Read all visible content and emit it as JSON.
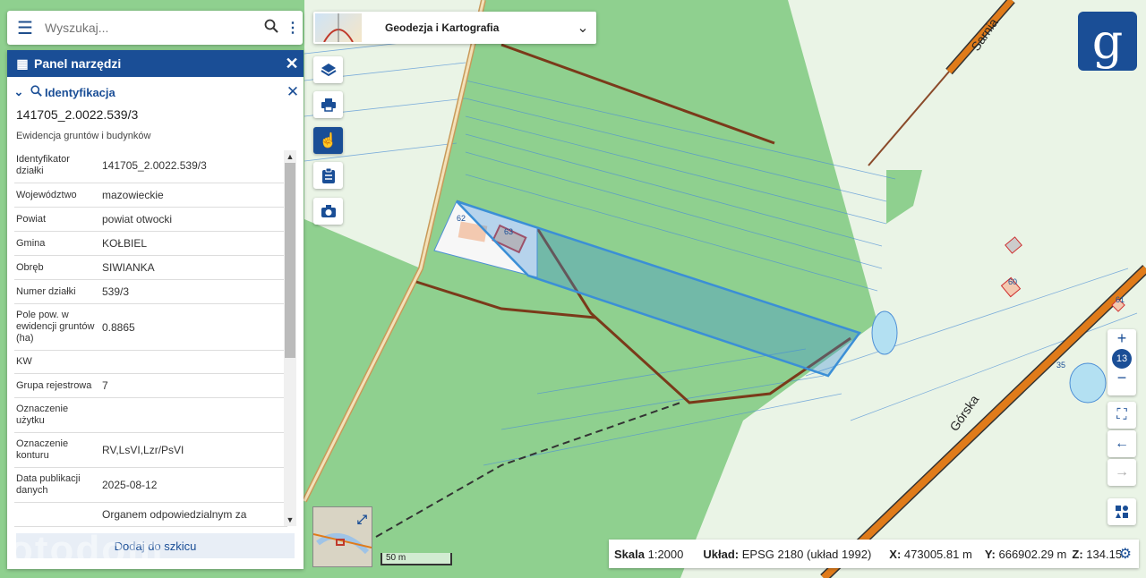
{
  "search": {
    "placeholder": "Wyszukaj..."
  },
  "tool_panel": {
    "title": "Panel narzędzi",
    "section_title": "Identyfikacja",
    "parcel_id": "141705_2.0022.539/3",
    "layer_name": "Ewidencja gruntów i budynków",
    "attributes": [
      {
        "key": "Identyfikator działki",
        "value": "141705_2.0022.539/3"
      },
      {
        "key": "Województwo",
        "value": "mazowieckie"
      },
      {
        "key": "Powiat",
        "value": "powiat otwocki"
      },
      {
        "key": "Gmina",
        "value": "KOŁBIEL"
      },
      {
        "key": "Obręb",
        "value": "SIWIANKA"
      },
      {
        "key": "Numer działki",
        "value": "539/3"
      },
      {
        "key": "Pole pow. w ewidencji gruntów (ha)",
        "value": "0.8865"
      },
      {
        "key": "KW",
        "value": ""
      },
      {
        "key": "Grupa rejestrowa",
        "value": "7"
      },
      {
        "key": "Oznaczenie użytku",
        "value": ""
      },
      {
        "key": "Oznaczenie konturu",
        "value": "RV,LsVI,Lzr/PsVI"
      },
      {
        "key": "Data publikacji danych",
        "value": "2025-08-12"
      },
      {
        "key": "",
        "value": "Organem odpowiedzialnym za"
      }
    ],
    "add_sketch_label": "Dodaj do szkicu"
  },
  "map_selector": {
    "label": "Geodezja i Kartografia"
  },
  "map_labels": {
    "street1": "Sarnia",
    "street2": "Górska",
    "parcel_62": "62",
    "parcel_63": "63",
    "parcel_60": "60",
    "parcel_61": "61",
    "parcel_35": "35"
  },
  "zoom": {
    "level": "13",
    "plus": "+",
    "minus": "−"
  },
  "scale_bar": {
    "label": "50 m"
  },
  "status": {
    "scale_label": "Skala",
    "scale_value": "1:2000",
    "crs_label": "Układ:",
    "crs_value": "EPSG 2180 (układ 1992)",
    "x_label": "X:",
    "x_value": "473005.81 m",
    "y_label": "Y:",
    "y_value": "666902.29 m",
    "z_label": "Z:",
    "z_value": "134.15"
  },
  "watermark": "otodom",
  "logo": "g",
  "icons": {
    "menu": "menu-icon",
    "search": "search-icon",
    "more": "more-vert-icon",
    "layers": "layers-icon",
    "print": "print-icon",
    "identify": "hand-pointer-icon",
    "clipboard": "clipboard-icon",
    "camera": "camera-icon",
    "fullscreen": "fullscreen-icon",
    "back": "arrow-left-icon",
    "forward": "arrow-right-icon",
    "legend": "legend-icon",
    "settings": "gear-icon"
  },
  "colors": {
    "accent": "#1a4e96",
    "forest": "#8fd08f",
    "selected_parcel": "#3b8fd6",
    "road": "#e07b1a"
  }
}
